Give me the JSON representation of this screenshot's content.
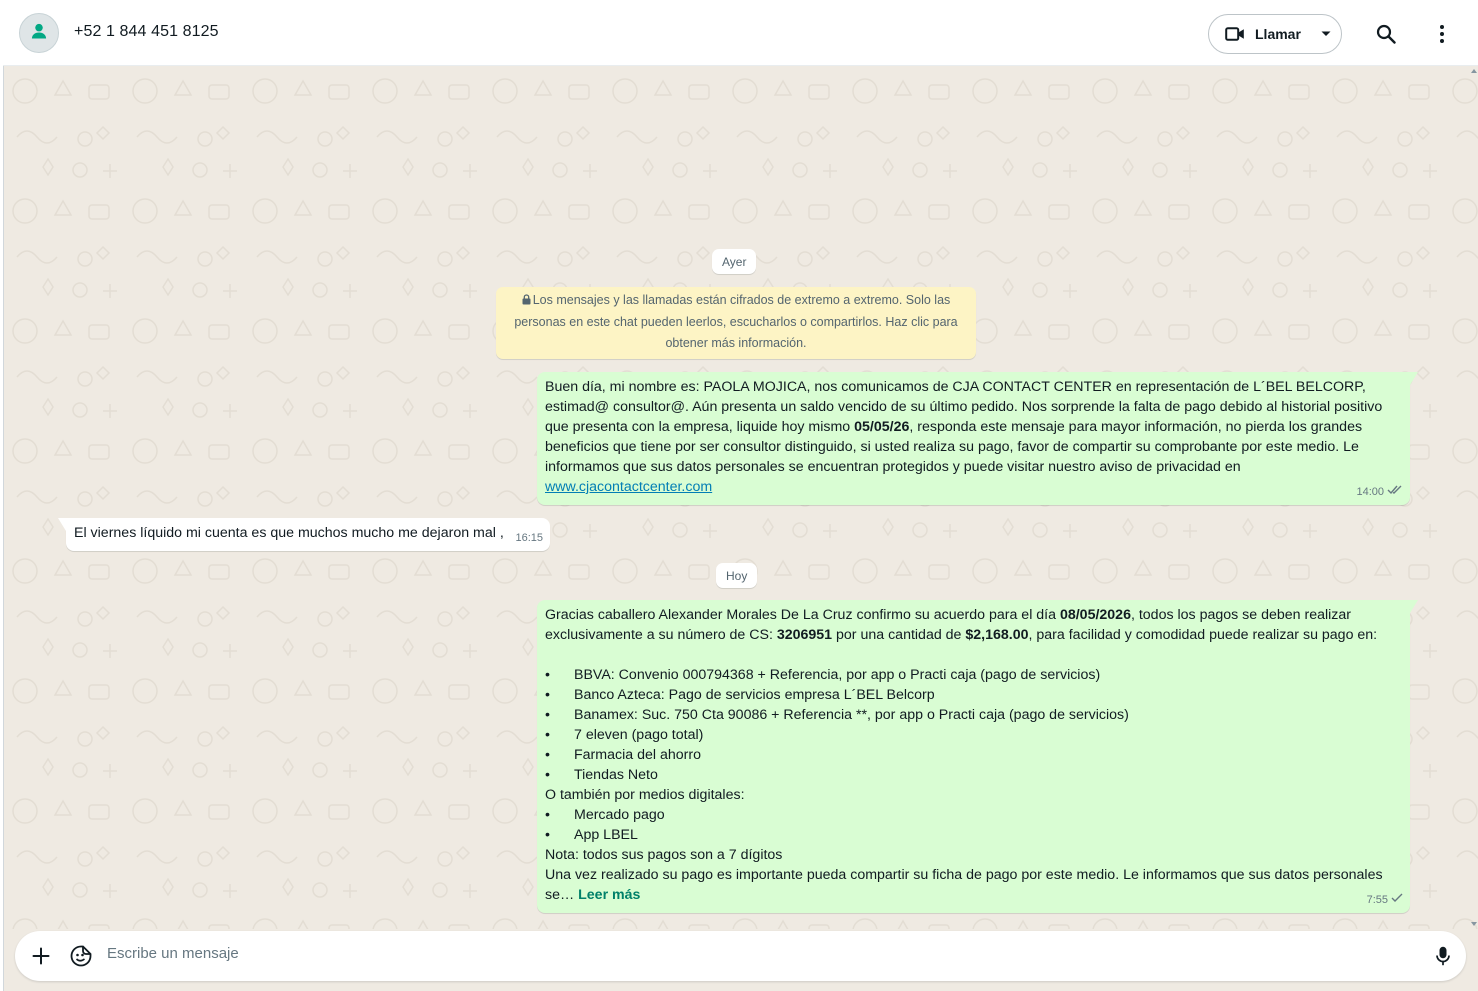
{
  "header": {
    "contact_name": "+52 1 844 451 8125",
    "call_label": "Llamar",
    "icons": [
      "avatar-person-icon",
      "video-camera-icon",
      "chevron-down-icon",
      "search-icon",
      "more-vertical-icon"
    ]
  },
  "chat": {
    "date_yesterday": "Ayer",
    "date_today": "Hoy",
    "encryption_notice": "Los mensajes y las llamadas están cifrados de extremo a extremo. Solo las personas en este chat pueden leerlos, escucharlos o compartirlos. Haz clic para obtener más información.",
    "messages": [
      {
        "direction": "outgoing",
        "text_before": "Buen día, mi nombre es: PAOLA MOJICA, nos comunicamos de CJA CONTACT CENTER en representación de L´BEL BELCORP, estimad@ consultor@. Aún presenta un saldo vencido de su último pedido. Nos sorprende la falta de pago debido al historial positivo que presenta con la empresa, liquide hoy mismo ",
        "bold_date": "05/05/26",
        "text_after": ", responda este mensaje para mayor información, no pierda los grandes beneficios que tiene por ser consultor distinguido, si usted realiza su pago, favor de compartir su comprobante por este medio. Le informamos que sus datos personales se encuentran protegidos y puede visitar nuestro aviso de privacidad en ",
        "link": "www.cjacontactcenter.com",
        "time": "14:00",
        "status": "read"
      },
      {
        "direction": "incoming",
        "text": "El viernes líquido mi cuenta es que muchos  mucho me dejaron mal ,",
        "time": "16:15"
      },
      {
        "direction": "outgoing",
        "p1_a": "Gracias caballero Alexander Morales De La Cruz confirmo su acuerdo para el día ",
        "p1_date": "08/05/2026",
        "p1_b": ", todos los pagos se deben realizar exclusivamente a su número de CS: ",
        "p1_cs": "3206951",
        "p1_c": " por una cantidad de ",
        "p1_amount": "$2,168.00",
        "p1_d": ", para facilidad y comodidad puede realizar su pago en:",
        "bullet_char": "•",
        "options": [
          "BBVA: Convenio 000794368 + Referencia, por app o Practi caja (pago de servicios)",
          "Banco Azteca: Pago de servicios empresa L´BEL Belcorp",
          "Banamex: Suc. 750 Cta 90086 + Referencia **, por app o Practi caja (pago de servicios)",
          "7 eleven (pago total)",
          "Farmacia del ahorro",
          "Tiendas Neto"
        ],
        "digital_heading": "O también por medios digitales:",
        "digital_options": [
          "Mercado pago",
          "App LBEL"
        ],
        "note": "Nota: todos sus pagos son a 7 dígitos",
        "closing": "Una vez realizado su pago es importante pueda compartir su ficha de pago por este medio. Le informamos que sus datos personales se…",
        "read_more": "Leer más",
        "time": "7:55",
        "status": "sent"
      }
    ]
  },
  "composer": {
    "placeholder": "Escribe un mensaje"
  },
  "colors": {
    "outgoing_bubble": "#d9fdd3",
    "incoming_bubble": "#ffffff",
    "chat_background": "#efeae2",
    "encryption_bg": "#fdf4c5",
    "accent_green": "#008069",
    "link": "#027eb5"
  }
}
